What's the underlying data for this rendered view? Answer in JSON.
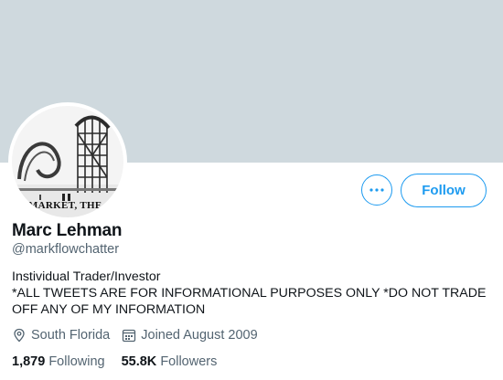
{
  "profile": {
    "name": "Marc Lehman",
    "handle": "@markflowchatter",
    "bio": "Instividual Trader/Investor\n *ALL  TWEETS ARE FOR INFORMATIONAL PURPOSES ONLY *DO NOT TRADE OFF ANY OF MY INFORMATION",
    "location": "South Florida",
    "joined": "Joined August 2009",
    "avatar_caption": "MARKET, THE"
  },
  "actions": {
    "more_label": "•••",
    "follow_label": "Follow"
  },
  "stats": {
    "following_count": "1,879",
    "following_label": "Following",
    "followers_count": "55.8K",
    "followers_label": "Followers"
  },
  "icons": {
    "location": "location-pin-icon",
    "joined": "calendar-icon"
  },
  "colors": {
    "banner": "#cfd9de",
    "accent": "#1d9bf0",
    "secondary_text": "#536471",
    "primary_text": "#0f1419"
  }
}
